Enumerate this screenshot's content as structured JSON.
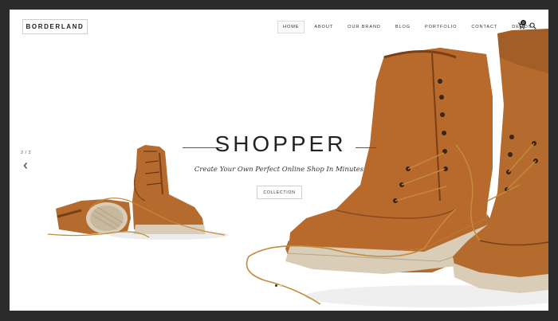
{
  "header": {
    "logo": "BORDERLAND",
    "nav": [
      {
        "label": "HOME",
        "active": true
      },
      {
        "label": "ABOUT",
        "active": false
      },
      {
        "label": "OUR BRAND",
        "active": false
      },
      {
        "label": "BLOG",
        "active": false
      },
      {
        "label": "PORTFOLIO",
        "active": false
      },
      {
        "label": "CONTACT",
        "active": false
      },
      {
        "label": "DEMOS",
        "active": false
      }
    ],
    "cart_count": "0"
  },
  "slider": {
    "counter": "2 / 2",
    "title": "SHOPPER",
    "subtitle": "Create Your Own Perfect Online Shop In Minutes",
    "button_label": "COLLECTION",
    "pagination": [
      {
        "active": true
      },
      {
        "active": false
      }
    ]
  },
  "colors": {
    "frame_bg": "#2b2b2b",
    "boot_leather": "#b56a2e",
    "boot_dark": "#7a3f17",
    "sole": "#d9cdb8"
  },
  "icons": {
    "cart": "cart-icon",
    "search": "search-icon",
    "prev": "chevron-left-icon"
  }
}
